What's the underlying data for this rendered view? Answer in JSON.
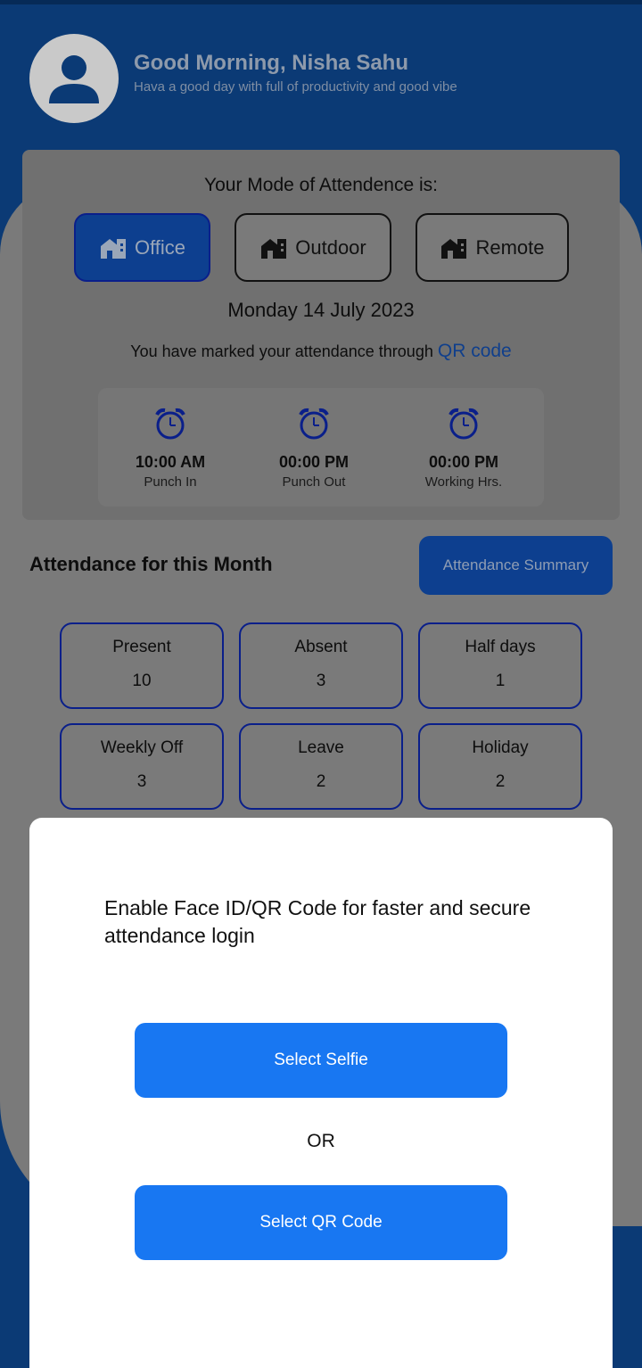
{
  "header": {
    "greeting": "Good Morning, Nisha Sahu",
    "subtitle": "Hava a good day with full of productivity and good vibe"
  },
  "attendance_mode": {
    "title": "Your Mode of Attendence is:",
    "options": [
      {
        "label": "Office",
        "icon": "building-icon",
        "selected": true
      },
      {
        "label": "Outdoor",
        "icon": "building-icon",
        "selected": false
      },
      {
        "label": "Remote",
        "icon": "building-icon",
        "selected": false
      }
    ],
    "date": "Monday 14 July 2023",
    "marked_text": "You have marked your attendance through",
    "marked_method": "QR code"
  },
  "punch": [
    {
      "time": "10:00 AM",
      "label": "Punch In",
      "icon": "alarm-clock-icon"
    },
    {
      "time": "00:00 PM",
      "label": "Punch Out",
      "icon": "alarm-clock-icon"
    },
    {
      "time": "00:00 PM",
      "label": "Working Hrs.",
      "icon": "alarm-clock-icon"
    }
  ],
  "month": {
    "title": "Attendance for this Month",
    "summary_button": "Attendance Summary",
    "stats": [
      {
        "label": "Present",
        "value": "10"
      },
      {
        "label": "Absent",
        "value": "3"
      },
      {
        "label": "Half days",
        "value": "1"
      },
      {
        "label": "Weekly Off",
        "value": "3"
      },
      {
        "label": "Leave",
        "value": "2"
      },
      {
        "label": "Holiday",
        "value": "2"
      }
    ]
  },
  "sheet": {
    "message": "Enable Face ID/QR Code for faster and secure attendance login",
    "selfie_button": "Select  Selfie",
    "or_text": "OR",
    "qr_button": "Select  QR Code"
  },
  "colors": {
    "brand_blue": "#0b3a75",
    "accent_blue": "#1877f2",
    "active_mode": "#0d3f8f",
    "overlay_grey": "#7a7a7a"
  }
}
